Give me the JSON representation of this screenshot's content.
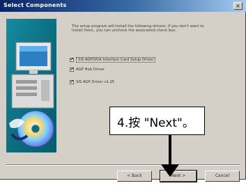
{
  "window": {
    "title": "Select Components",
    "close_glyph": "×"
  },
  "message": "The setup program will install the following drivers. If you don't want to install them, you can uncheck the associated check box.",
  "options": [
    {
      "label": "SiS AGP/VGA Interface Card Setup Driver",
      "checked": true
    },
    {
      "label": "AGP Hub Driver",
      "checked": true
    },
    {
      "label": "SiS AGP Driver v1.25",
      "checked": true
    }
  ],
  "buttons": {
    "back": "< Back",
    "next": "Next >",
    "cancel": "Cancel"
  },
  "callout": {
    "text": "4.按 \"Next\"。"
  },
  "icons": {
    "art": "computer-and-cd-icon",
    "arrow": "down-arrow-icon",
    "check": "✔"
  }
}
